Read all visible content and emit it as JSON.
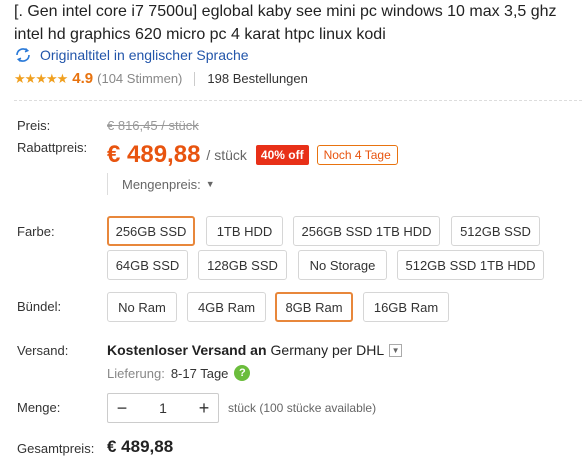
{
  "product": {
    "title": "[. Gen intel core i7 7500u] eglobal kaby see mini pc windows 10 max 3,5 ghz intel hd graphics 620 micro pc 4 karat htpc linux kodi",
    "original_title_link": "Originaltitel in englischer Sprache",
    "rating": "4.9",
    "rating_stars": 5,
    "votes": "(104 Stimmen)",
    "orders": "198 Bestellungen"
  },
  "pricing": {
    "price_label": "Preis:",
    "old_price": "€ 816,45 / stück",
    "discount_price_label": "Rabattpreis:",
    "price": "€ 489,88",
    "per_unit": "/ stück",
    "discount_badge": "40% off",
    "time_left": "Noch 4 Tage",
    "bulk_price": "Mengenpreis:"
  },
  "options": {
    "color_label": "Farbe:",
    "colors": [
      "256GB SSD",
      "1TB HDD",
      "256GB SSD 1TB HDD",
      "512GB SSD",
      "64GB SSD",
      "128GB SSD",
      "No Storage",
      "512GB SSD 1TB HDD"
    ],
    "selected_color": "256GB SSD",
    "bundle_label": "Bündel:",
    "bundles": [
      "No Ram",
      "4GB Ram",
      "8GB Ram",
      "16GB Ram"
    ],
    "selected_bundle": "8GB Ram"
  },
  "shipping": {
    "label": "Versand:",
    "free_shipping": "Kostenloser Versand an",
    "destination": "Germany per DHL",
    "delivery_label": "Lieferung:",
    "delivery_time": "8-17 Tage"
  },
  "quantity": {
    "label": "Menge:",
    "value": "1",
    "minus": "−",
    "plus": "+",
    "info": "stück (100 stücke available)"
  },
  "total": {
    "label": "Gesamtpreis:",
    "value": "€ 489,88"
  },
  "colors": {
    "accent_orange": "#e8540f",
    "discount_red": "#e83018",
    "link_blue": "#2255aa",
    "star_gold": "#f0a020",
    "help_green": "#6bbd3c"
  }
}
